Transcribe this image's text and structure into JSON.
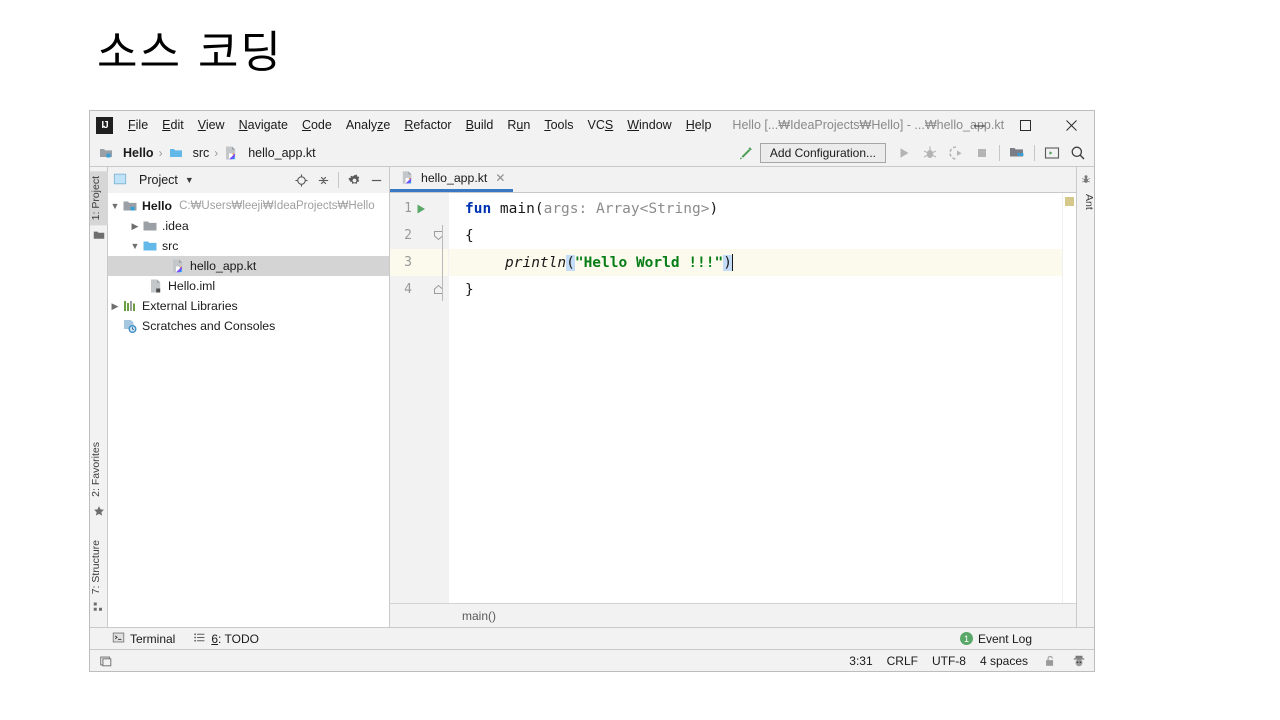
{
  "slide": {
    "title": "소스 코딩"
  },
  "window": {
    "title": "Hello [...₩IdeaProjects₩Hello] - ...₩hello_app.kt",
    "logo_text": "IJ",
    "controls": {
      "minimize": "minimize-icon",
      "maximize": "maximize-icon",
      "close": "close-icon"
    }
  },
  "menu": {
    "items": [
      {
        "label": "File",
        "mnemonic": "F"
      },
      {
        "label": "Edit",
        "mnemonic": "E"
      },
      {
        "label": "View",
        "mnemonic": "V"
      },
      {
        "label": "Navigate",
        "mnemonic": "N"
      },
      {
        "label": "Code",
        "mnemonic": "C"
      },
      {
        "label": "Analyze",
        "mnemonic": "z"
      },
      {
        "label": "Refactor",
        "mnemonic": "R"
      },
      {
        "label": "Build",
        "mnemonic": "B"
      },
      {
        "label": "Run",
        "mnemonic": "u"
      },
      {
        "label": "Tools",
        "mnemonic": "T"
      },
      {
        "label": "VCS",
        "mnemonic": "S"
      },
      {
        "label": "Window",
        "mnemonic": "W"
      },
      {
        "label": "Help",
        "mnemonic": "H"
      }
    ]
  },
  "navbar": {
    "crumbs": [
      {
        "label": "Hello",
        "icon": "module-icon"
      },
      {
        "label": "src",
        "icon": "source-folder-icon"
      },
      {
        "label": "hello_app.kt",
        "icon": "kotlin-file-icon"
      }
    ],
    "separator": "›",
    "build_icon": "build-hammer-icon",
    "add_configuration": "Add Configuration...",
    "actions": [
      {
        "name": "run-icon",
        "enabled": false
      },
      {
        "name": "debug-icon",
        "enabled": false
      },
      {
        "name": "run-with-coverage-icon",
        "enabled": false
      },
      {
        "name": "stop-icon",
        "enabled": false
      },
      {
        "name": "project-structure-icon",
        "enabled": true
      },
      {
        "name": "terminal-icon",
        "enabled": true
      },
      {
        "name": "search-everywhere-icon",
        "enabled": true
      }
    ]
  },
  "left_strip": {
    "tabs": [
      {
        "label": "1: Project",
        "mnemonic": "1",
        "active": true,
        "icon": "project-folder-icon"
      },
      {
        "label": "2: Favorites",
        "mnemonic": "2",
        "active": false,
        "icon": "star-icon"
      },
      {
        "label": "7: Structure",
        "mnemonic": "7",
        "active": false,
        "icon": "structure-icon"
      }
    ]
  },
  "right_strip": {
    "tabs": [
      {
        "label": "Ant",
        "icon": "ant-icon"
      }
    ]
  },
  "project_panel": {
    "title": "Project",
    "dropdown_icon": "chevron-down-icon",
    "toolbar_icons": [
      "locate-target-icon",
      "collapse-all-icon",
      "settings-gear-icon",
      "hide-minus-icon"
    ],
    "tree": [
      {
        "depth": 0,
        "twisty": "expanded",
        "icon": "module-icon",
        "label": "Hello",
        "bold": true,
        "path": "C:₩Users₩leeji₩IdeaProjects₩Hello",
        "selected": false
      },
      {
        "depth": 1,
        "twisty": "collapsed",
        "icon": "folder-icon",
        "label": ".idea",
        "bold": false,
        "path": "",
        "selected": false
      },
      {
        "depth": 1,
        "twisty": "expanded",
        "icon": "source-folder-icon",
        "label": "src",
        "bold": false,
        "path": "",
        "selected": false
      },
      {
        "depth": 2,
        "twisty": "none",
        "icon": "kotlin-file-icon",
        "label": "hello_app.kt",
        "bold": false,
        "path": "",
        "selected": true
      },
      {
        "depth": 2,
        "twisty": "none",
        "icon": "iml-file-icon",
        "label": "Hello.iml",
        "bold": false,
        "path": "",
        "selected": false
      },
      {
        "depth": 0,
        "twisty": "collapsed",
        "icon": "libraries-icon",
        "label": "External Libraries",
        "bold": false,
        "path": "",
        "selected": false
      },
      {
        "depth": 0,
        "twisty": "none",
        "icon": "scratches-icon",
        "label": "Scratches and Consoles",
        "bold": false,
        "path": "",
        "selected": false
      }
    ]
  },
  "editor": {
    "tab": {
      "label": "hello_app.kt",
      "icon": "kotlin-file-icon",
      "close_icon": "close-icon"
    },
    "lines": [
      {
        "num": "1",
        "gutter_icon": "run-green-triangle-icon",
        "fold": "none",
        "highlight": false
      },
      {
        "num": "2",
        "gutter_icon": "",
        "fold": "fold-start",
        "highlight": false
      },
      {
        "num": "3",
        "gutter_icon": "",
        "fold": "none",
        "highlight": true
      },
      {
        "num": "4",
        "gutter_icon": "",
        "fold": "fold-end",
        "highlight": false
      }
    ],
    "code": {
      "l1_kw": "fun",
      "l1_name": " main",
      "l1_paren_open": "(",
      "l1_params": "args: Array<String>",
      "l1_paren_close": ")",
      "l2": "{",
      "l3_fn": "println",
      "l3_open": "(",
      "l3_str": "\"Hello World !!!\"",
      "l3_close": ")",
      "l4": "}"
    },
    "breadcrumb": "main()",
    "marker": "warning-marker"
  },
  "tool_windows": {
    "terminal": {
      "label": "Terminal",
      "icon": "terminal-icon"
    },
    "todo": {
      "label": "6: TODO",
      "mnemonic": "6",
      "icon": "todo-list-icon"
    },
    "event_log": {
      "label": "Event Log",
      "badge": "1",
      "badge_color": "#59a869"
    }
  },
  "status_bar": {
    "left_icon": "toggle-toolwindows-icon",
    "position": "3:31",
    "line_separator": "CRLF",
    "encoding": "UTF-8",
    "indent": "4 spaces",
    "lock_icon": "unlocked-padlock-icon",
    "hector_icon": "inspection-hector-icon"
  },
  "colors": {
    "accent_tab_underline": "#3b78c3",
    "keyword_blue": "#0033b3",
    "string_green": "#067d17",
    "bracket_highlight": "#c3dcf7",
    "current_line": "#fcfaed",
    "event_badge_green": "#59a869",
    "chrome_gray": "#f2f2f2"
  }
}
